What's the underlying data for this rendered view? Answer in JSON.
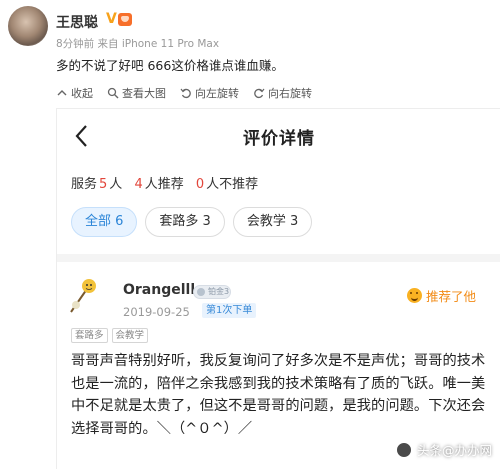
{
  "post": {
    "author": "王思聪",
    "verified_mark": "V",
    "meta": "8分钟前 来自 iPhone 11 Pro Max",
    "text": "多的不说了好吧 666这价格谁点谁血赚。"
  },
  "image_toolbar": [
    {
      "icon": "collapse-icon",
      "label": "收起"
    },
    {
      "icon": "search-icon",
      "label": "查看大图"
    },
    {
      "icon": "rotate-left-icon",
      "label": "向左旋转"
    },
    {
      "icon": "rotate-right-icon",
      "label": "向右旋转"
    }
  ],
  "review_page": {
    "title": "评价详情",
    "stats": {
      "service_label": "服务",
      "people_count": "5",
      "people_unit": "人",
      "recommend_count": "4",
      "recommend_label": "人推荐",
      "not_recommend_count": "0",
      "not_recommend_label": "人不推荐"
    },
    "filters": [
      {
        "label": "全部 6",
        "active": true
      },
      {
        "label": "套路多 3",
        "active": false
      },
      {
        "label": "会教学 3",
        "active": false
      }
    ],
    "review": {
      "username": "Orangelll",
      "level_badge": "铂金3",
      "date": "2019-09-25",
      "order_tag": "第1次下单",
      "recommend_label": "推荐了他",
      "tags": [
        "套路多",
        "会教学"
      ],
      "text": "哥哥声音特别好听，我反复询问了好多次是不是声优；哥哥的技术也是一流的，陪伴之余我感到我的技术策略有了质的飞跃。唯一美中不足就是太贵了，但这不是哥哥的问题，是我的问题。下次还会选择哥哥的。＼（^０^）／"
    },
    "watermark": "头条@办办网"
  },
  "colors": {
    "accent_red": "#e2463b",
    "active_chip_text": "#2a84d7",
    "recommend_orange": "#f28b16",
    "verified_gold": "#f7a21b"
  }
}
